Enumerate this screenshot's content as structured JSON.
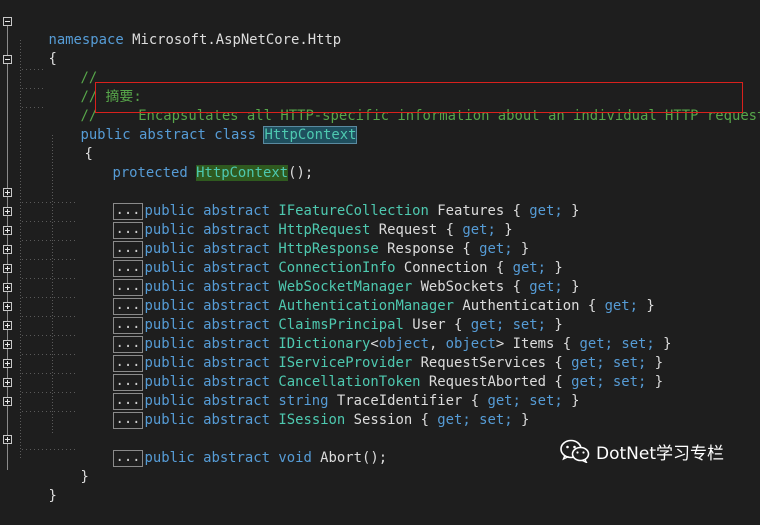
{
  "lines": {
    "l1": {
      "kw": "namespace",
      "rest": " Microsoft.AspNetCore.Http"
    },
    "l2": {
      "text": "{"
    },
    "l3": {
      "text": "//"
    },
    "l4": {
      "text": "// 摘要:"
    },
    "l5": {
      "slashes": "//",
      "summary": "Encapsulates all HTTP-specific information about an individual HTTP request."
    },
    "l6": {
      "kw": "public abstract class",
      "type": "HttpContext"
    },
    "l7": {
      "text": "{"
    },
    "l8": {
      "kw": "protected",
      "type": "HttpContext",
      "rest": "();"
    },
    "members": [
      {
        "kw": "public abstract",
        "type": "IFeatureCollection",
        "name": "Features",
        "accessors": "get;"
      },
      {
        "kw": "public abstract",
        "type": "HttpRequest",
        "name": "Request",
        "accessors": "get;"
      },
      {
        "kw": "public abstract",
        "type": "HttpResponse",
        "name": "Response",
        "accessors": "get;"
      },
      {
        "kw": "public abstract",
        "type": "ConnectionInfo",
        "name": "Connection",
        "accessors": "get;"
      },
      {
        "kw": "public abstract",
        "type": "WebSocketManager",
        "name": "WebSockets",
        "accessors": "get;"
      },
      {
        "kw": "public abstract",
        "type": "AuthenticationManager",
        "name": "Authentication",
        "accessors": "get;"
      },
      {
        "kw": "public abstract",
        "type": "ClaimsPrincipal",
        "name": "User",
        "accessors": "get; set;"
      },
      {
        "kw": "public abstract",
        "type": "IDictionary",
        "generic_a": "object",
        "generic_b": "object",
        "name": "Items",
        "accessors": "get; set;"
      },
      {
        "kw": "public abstract",
        "type": "IServiceProvider",
        "name": "RequestServices",
        "accessors": "get; set;"
      },
      {
        "kw": "public abstract",
        "type": "CancellationToken",
        "name": "RequestAborted",
        "accessors": "get; set;"
      },
      {
        "kw": "public abstract string",
        "type": "",
        "name": "TraceIdentifier",
        "accessors": "get; set;"
      },
      {
        "kw": "public abstract",
        "type": "ISession",
        "name": "Session",
        "accessors": "get; set;"
      }
    ],
    "abort": {
      "kw": "public abstract void",
      "rest": " Abort();"
    },
    "close_class": "}",
    "close_ns": "}"
  },
  "ellipsis": "...",
  "watermark": {
    "icon": "wechat-icon",
    "text": "DotNet学习专栏"
  },
  "colors": {
    "background": "#1e1e1e",
    "keyword": "#569cd6",
    "type": "#4ec9b0",
    "comment": "#57a64a",
    "highlight_box": "#d9211d"
  }
}
